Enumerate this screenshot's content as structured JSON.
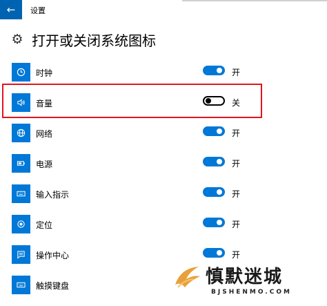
{
  "window": {
    "title": "设置"
  },
  "header": {
    "title": "打开或关闭系统图标"
  },
  "items": [
    {
      "label": "时钟",
      "state": "开",
      "on": true,
      "icon": "clock-icon"
    },
    {
      "label": "音量",
      "state": "关",
      "on": false,
      "icon": "volume-icon"
    },
    {
      "label": "网络",
      "state": "开",
      "on": true,
      "icon": "network-icon"
    },
    {
      "label": "电源",
      "state": "开",
      "on": true,
      "icon": "battery-icon"
    },
    {
      "label": "输入指示",
      "state": "开",
      "on": true,
      "icon": "keyboard-icon"
    },
    {
      "label": "定位",
      "state": "开",
      "on": true,
      "icon": "location-icon"
    },
    {
      "label": "操作中心",
      "state": "开",
      "on": true,
      "icon": "action-center-icon"
    },
    {
      "label": "触摸键盘",
      "state": "",
      "on": null,
      "icon": "touch-keyboard-icon"
    }
  ],
  "watermark": {
    "text": "慎默迷城",
    "subtext": "BJSHENMO.COM"
  },
  "colors": {
    "accent": "#0078d7",
    "back_button": "#0063b1",
    "highlight": "#e0141e"
  }
}
